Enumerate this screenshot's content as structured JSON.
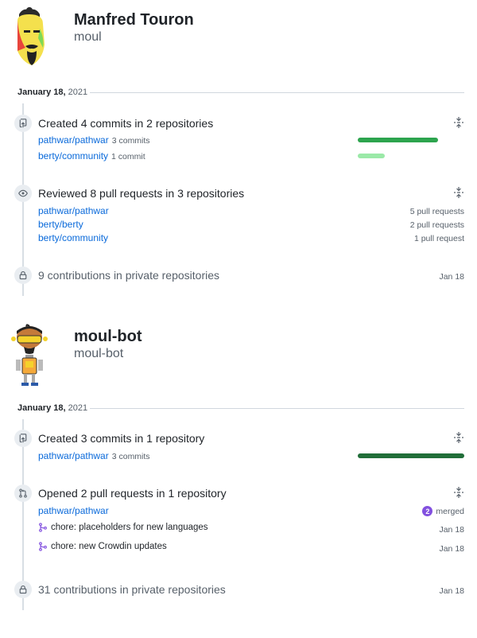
{
  "profiles": [
    {
      "name": "Manfred Touron",
      "login": "moul",
      "date": {
        "day": "January 18,",
        "year": "2021"
      },
      "commits": {
        "summary": "Created 4 commits in 2 repositories",
        "repos": [
          {
            "name": "pathwar/pathwar",
            "count": "3 commits",
            "share": 0.75
          },
          {
            "name": "berty/community",
            "count": "1 commit",
            "share": 0.25
          }
        ]
      },
      "reviews": {
        "summary": "Reviewed 8 pull requests in 3 repositories",
        "repos": [
          {
            "name": "pathwar/pathwar",
            "count": "5 pull requests"
          },
          {
            "name": "berty/berty",
            "count": "2 pull requests"
          },
          {
            "name": "berty/community",
            "count": "1 pull request"
          }
        ]
      },
      "private": {
        "summary": "9 contributions in private repositories",
        "date": "Jan 18"
      }
    },
    {
      "name": "moul-bot",
      "login": "moul-bot",
      "date": {
        "day": "January 18,",
        "year": "2021"
      },
      "commits": {
        "summary": "Created 3 commits in 1 repository",
        "repos": [
          {
            "name": "pathwar/pathwar",
            "count": "3 commits",
            "share": 1.0
          }
        ]
      },
      "pulls": {
        "summary": "Opened 2 pull requests in 1 repository",
        "repo": "pathwar/pathwar",
        "merged_count": "2",
        "merged_label": "merged",
        "items": [
          {
            "title": "chore: placeholders for new languages",
            "date": "Jan 18"
          },
          {
            "title": "chore: new Crowdin updates",
            "date": "Jan 18"
          }
        ]
      },
      "private": {
        "summary": "31 contributions in private repositories",
        "date": "Jan 18"
      }
    }
  ],
  "colors": {
    "link": "#0969da",
    "bar_dark": "#2da44e",
    "bar_light": "#9be9a8",
    "bar_darkest": "#216e39",
    "merged": "#8250df"
  },
  "icons": {
    "commit": "repo-push-icon",
    "review": "eye-icon",
    "lock": "lock-icon",
    "pull": "git-pull-request-icon",
    "merged": "git-merge-icon",
    "collapse": "fold-icon"
  }
}
